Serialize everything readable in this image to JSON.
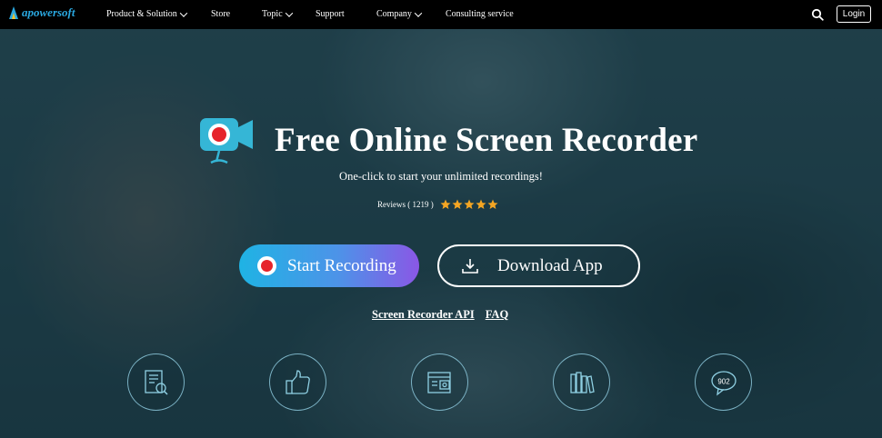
{
  "nav": {
    "logo_text": "apowersoft",
    "items": [
      {
        "label": "Product & Solution",
        "has_dropdown": true
      },
      {
        "label": "Store",
        "has_dropdown": false
      },
      {
        "label": "Topic",
        "has_dropdown": true
      },
      {
        "label": "Support",
        "has_dropdown": false
      },
      {
        "label": "Company",
        "has_dropdown": true
      },
      {
        "label": "Consulting service",
        "has_dropdown": false
      }
    ],
    "search_icon": "search-icon",
    "login_label": "Login"
  },
  "hero": {
    "title": "Free Online Screen Recorder",
    "subtitle": "One-click to start your unlimited recordings!",
    "reviews_label": "Reviews ( 1219 )",
    "rating": 5,
    "rating_max": 5,
    "start_button_label": "Start Recording",
    "download_button_label": "Download App",
    "links": [
      {
        "label": "Screen Recorder API"
      },
      {
        "label": "FAQ"
      }
    ]
  },
  "features": [
    {
      "icon": "document-search-icon"
    },
    {
      "icon": "thumbs-up-icon"
    },
    {
      "icon": "browser-window-icon"
    },
    {
      "icon": "books-icon"
    },
    {
      "icon": "chat-bubble-icon",
      "label": "902"
    }
  ],
  "colors": {
    "nav_bg": "#000000",
    "accent_blue": "#1fb3e4",
    "accent_purple": "#8a57e6",
    "record_red": "#e6232a",
    "star": "#f5a623",
    "logo": "#2aa8e0"
  }
}
